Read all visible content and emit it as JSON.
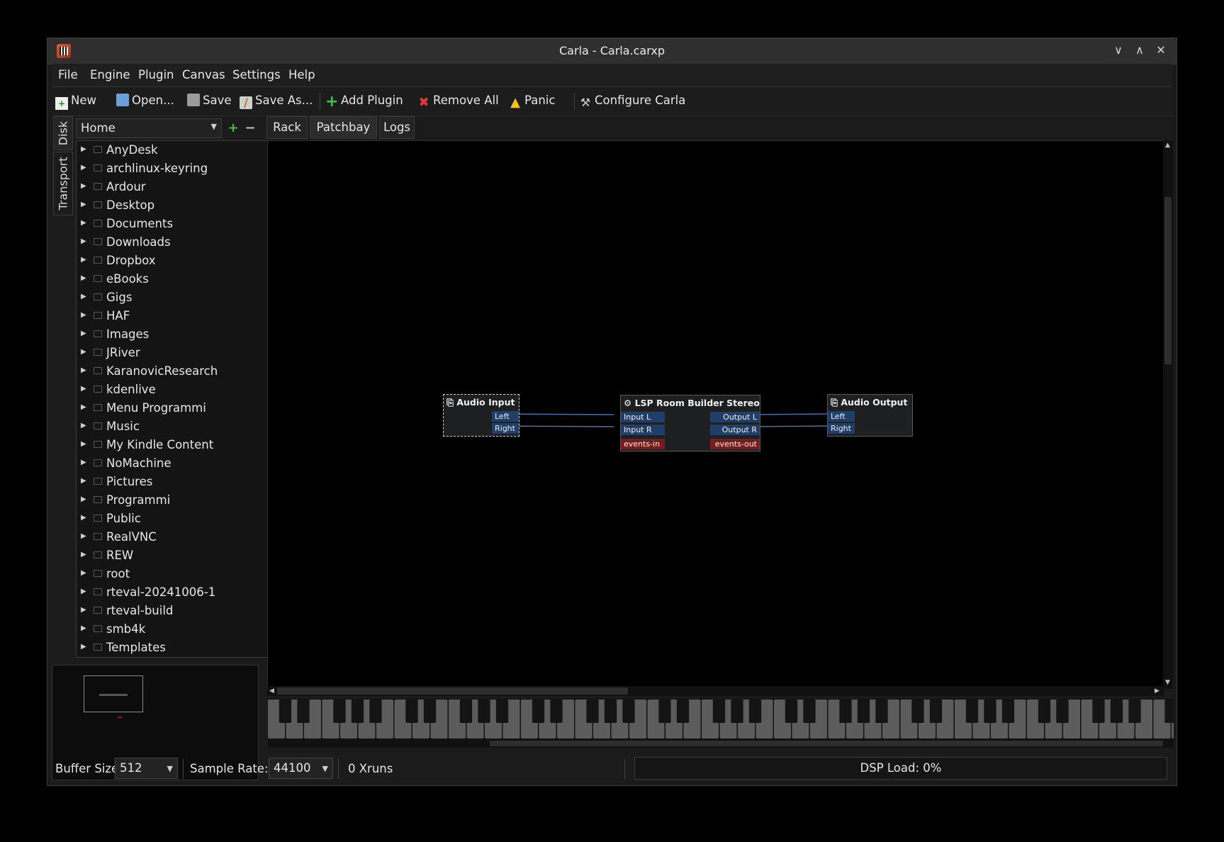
{
  "window": {
    "title": "Carla - Carla.carxp",
    "min_glyph": "∨",
    "max_glyph": "∧",
    "close_glyph": "✕"
  },
  "menu": [
    "File",
    "Engine",
    "Plugin",
    "Canvas",
    "Settings",
    "Help"
  ],
  "toolbar": {
    "new": "New",
    "open": "Open...",
    "save": "Save",
    "save_as": "Save As...",
    "add_plugin": "Add Plugin",
    "remove_all": "Remove All",
    "panic": "Panic",
    "configure": "Configure Carla"
  },
  "side_tabs": {
    "disk": "Disk",
    "transport": "Transport"
  },
  "filesystem": {
    "current_path": "Home",
    "folders": [
      "AnyDesk",
      "archlinux-keyring",
      "Ardour",
      "Desktop",
      "Documents",
      "Downloads",
      "Dropbox",
      "eBooks",
      "Gigs",
      "HAF",
      "Images",
      "JRiver",
      "KaranovicResearch",
      "kdenlive",
      "Menu Programmi",
      "Music",
      "My Kindle Content",
      "NoMachine",
      "Pictures",
      "Programmi",
      "Public",
      "RealVNC",
      "REW",
      "root",
      "rteval-20241006-1",
      "rteval-build",
      "smb4k",
      "Templates"
    ]
  },
  "tabs": [
    "Rack",
    "Patchbay",
    "Logs"
  ],
  "patchbay": {
    "audio_input": {
      "title": "Audio Input",
      "ports": [
        "Left",
        "Right"
      ]
    },
    "plugin": {
      "title": "LSP Room Builder Stereo",
      "inputs": [
        "Input L",
        "Input R"
      ],
      "outputs": [
        "Output L",
        "Output R"
      ],
      "event_in": "events-in",
      "event_out": "events-out"
    },
    "audio_output": {
      "title": "Audio Output",
      "ports": [
        "Left",
        "Right"
      ]
    },
    "colors": {
      "audio_port": "#1f3e69",
      "event_port": "#7a1a1a",
      "connection": "#4a6fa8"
    }
  },
  "status": {
    "buffer_label": "Buffer Size:",
    "buffer_value": "512",
    "rate_label": "Sample Rate:",
    "rate_value": "44100",
    "xruns": "0 Xruns",
    "dsp": "DSP Load: 0%"
  }
}
